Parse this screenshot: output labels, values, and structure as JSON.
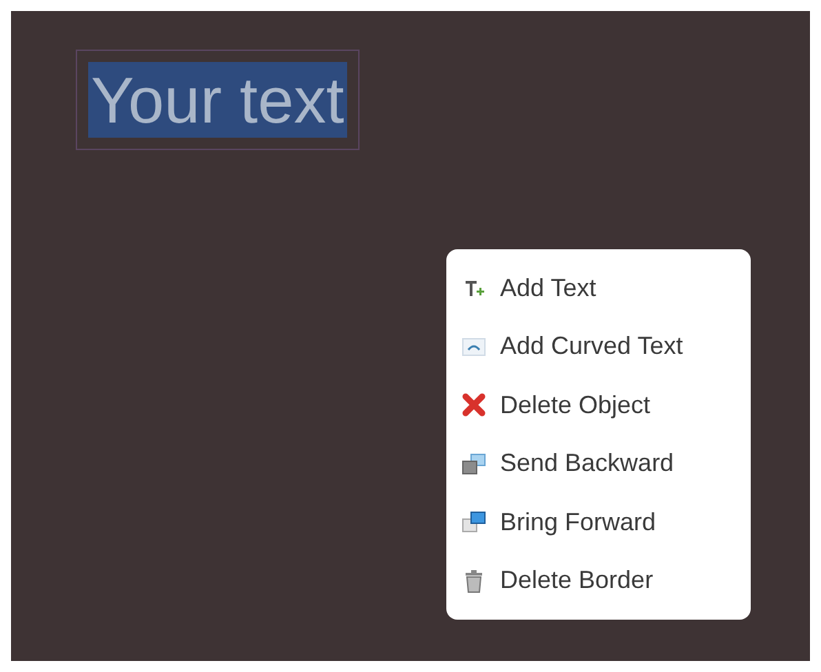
{
  "canvas": {
    "text_object": {
      "text": "Your text",
      "selected": true
    }
  },
  "context_menu": {
    "items": [
      {
        "label": "Add Text",
        "kind": "add-text"
      },
      {
        "label": "Add Curved Text",
        "kind": "curved-text"
      },
      {
        "label": "Delete Object",
        "kind": "delete"
      },
      {
        "label": "Send Backward",
        "kind": "send-backward"
      },
      {
        "label": "Bring Forward",
        "kind": "bring-forward"
      },
      {
        "label": "Delete Border",
        "kind": "trash"
      }
    ]
  }
}
